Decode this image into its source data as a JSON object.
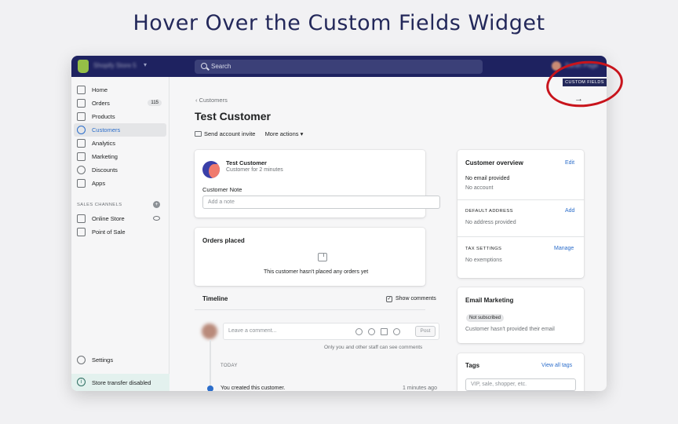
{
  "headline": "Hover Over the Custom Fields Widget",
  "topbar": {
    "store_name": "Shopify Store 5",
    "search_placeholder": "Search",
    "user_name": "Sarah Page",
    "custom_fields_label": "CUSTOM FIELDS",
    "arrow": "→"
  },
  "sidebar": {
    "items": [
      {
        "label": "Home",
        "icon": "home-icon"
      },
      {
        "label": "Orders",
        "icon": "orders-icon",
        "count": "115"
      },
      {
        "label": "Products",
        "icon": "tag-icon"
      },
      {
        "label": "Customers",
        "icon": "person-icon",
        "active": true
      },
      {
        "label": "Analytics",
        "icon": "bar-chart-icon"
      },
      {
        "label": "Marketing",
        "icon": "target-icon"
      },
      {
        "label": "Discounts",
        "icon": "discount-icon"
      },
      {
        "label": "Apps",
        "icon": "apps-icon"
      }
    ],
    "sales_channels_label": "SALES CHANNELS",
    "channels": [
      {
        "label": "Online Store",
        "icon": "store-icon"
      },
      {
        "label": "Point of Sale",
        "icon": "pos-icon"
      }
    ],
    "settings_label": "Settings",
    "store_transfer_label": "Store transfer disabled"
  },
  "main": {
    "breadcrumb": "Customers",
    "title": "Test Customer",
    "actions": {
      "send_invite": "Send account invite",
      "more_actions": "More actions"
    },
    "customer_card": {
      "name": "Test Customer",
      "subtitle": "Customer for 2 minutes",
      "note_label": "Customer Note",
      "note_placeholder": "Add a note"
    },
    "orders_card": {
      "title": "Orders placed",
      "empty_text": "This customer hasn't placed any orders yet"
    },
    "timeline": {
      "title": "Timeline",
      "show_comments": "Show comments",
      "comment_placeholder": "Leave a comment...",
      "post_label": "Post",
      "staff_note": "Only you and other staff can see comments",
      "today_label": "TODAY",
      "event_text": "You created this customer.",
      "event_time": "1 minutes ago"
    }
  },
  "right": {
    "overview": {
      "title": "Customer overview",
      "edit": "Edit",
      "email": "No email provided",
      "account": "No account",
      "default_address_label": "DEFAULT ADDRESS",
      "add": "Add",
      "address": "No address provided",
      "tax_label": "TAX SETTINGS",
      "manage": "Manage",
      "exemptions": "No exemptions"
    },
    "email_marketing": {
      "title": "Email Marketing",
      "badge": "Not subscribed",
      "text": "Customer hasn't provided their email"
    },
    "tags": {
      "title": "Tags",
      "view_all": "View all tags",
      "placeholder": "VIP, sale, shopper, etc."
    }
  },
  "colors": {
    "topbar": "#1e2260",
    "link": "#2c6ecb",
    "highlight_ring": "#c8141c"
  }
}
